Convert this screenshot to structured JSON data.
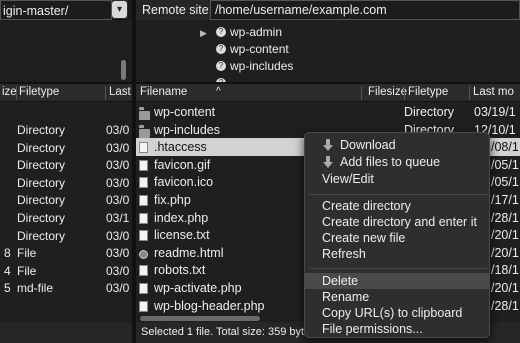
{
  "local": {
    "path": "igin-master/",
    "headers": {
      "size": "ize",
      "filetype": "Filetype",
      "last": "Last"
    },
    "rows": [
      {
        "size": "",
        "type": "Directory",
        "last": "03/0"
      },
      {
        "size": "",
        "type": "Directory",
        "last": "03/0"
      },
      {
        "size": "",
        "type": "Directory",
        "last": "03/0"
      },
      {
        "size": "",
        "type": "Directory",
        "last": "03/0"
      },
      {
        "size": "",
        "type": "Directory",
        "last": "03/0"
      },
      {
        "size": "",
        "type": "Directory",
        "last": "03/1"
      },
      {
        "size": "",
        "type": "Directory",
        "last": "03/0"
      },
      {
        "size": "8",
        "type": "File",
        "last": "03/0"
      },
      {
        "size": "4",
        "type": "File",
        "last": "03/0"
      },
      {
        "size": "5",
        "type": "md-file",
        "last": "03/0"
      }
    ]
  },
  "remote": {
    "label": "Remote site:",
    "path": "/home/username/example.com",
    "tree": [
      {
        "name": "wp-admin",
        "icon": "folder-icon"
      },
      {
        "name": "wp-content",
        "icon": "folder-icon"
      },
      {
        "name": "wp-includes",
        "icon": "folder-icon"
      }
    ],
    "headers": {
      "filename": "Filename",
      "sort": "^",
      "filesize": "Filesize",
      "filetype": "Filetype",
      "last": "Last mo"
    },
    "rows": [
      {
        "name": "wp-content",
        "icon": "folder-icon",
        "type": "Directory",
        "date": "03/19/1"
      },
      {
        "name": "wp-includes",
        "icon": "folder-icon",
        "type": "Directory",
        "date": "12/10/1"
      },
      {
        "name": ".htaccess",
        "icon": "file-icon",
        "type": "",
        "date": "/08/1"
      },
      {
        "name": "favicon.gif",
        "icon": "file-icon",
        "type": "",
        "date": "/05/1"
      },
      {
        "name": "favicon.ico",
        "icon": "file-icon",
        "type": "",
        "date": "/05/1"
      },
      {
        "name": "fix.php",
        "icon": "file-icon",
        "type": "",
        "date": "/17/1"
      },
      {
        "name": "index.php",
        "icon": "file-icon",
        "type": "",
        "date": "/28/1"
      },
      {
        "name": "license.txt",
        "icon": "file-icon",
        "type": "",
        "date": "/20/1"
      },
      {
        "name": "readme.html",
        "icon": "html-icon",
        "type": "",
        "date": "/20/1"
      },
      {
        "name": "robots.txt",
        "icon": "file-icon",
        "type": "",
        "date": "/18/1"
      },
      {
        "name": "wp-activate.php",
        "icon": "file-icon",
        "type": "",
        "date": "/20/1"
      },
      {
        "name": "wp-blog-header.php",
        "icon": "file-icon",
        "type": "",
        "date": "/28/1"
      }
    ],
    "status": "Selected 1 file. Total size: 359 byte"
  },
  "context_menu": {
    "items": [
      {
        "label": "Download",
        "icon": "download-icon"
      },
      {
        "label": "Add files to queue",
        "icon": "queue-icon"
      },
      {
        "label": "View/Edit"
      },
      {
        "label": "Create directory"
      },
      {
        "label": "Create directory and enter it"
      },
      {
        "label": "Create new file"
      },
      {
        "label": "Refresh"
      },
      {
        "label": "Delete"
      },
      {
        "label": "Rename"
      },
      {
        "label": "Copy URL(s) to clipboard"
      },
      {
        "label": "File permissions..."
      }
    ]
  }
}
